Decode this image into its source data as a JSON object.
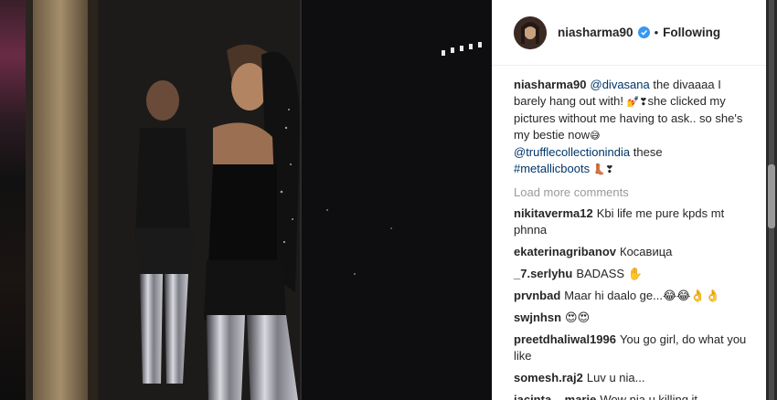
{
  "post": {
    "author": "niasharma90",
    "follow_status": "Following",
    "separator": "•",
    "caption": {
      "username": "niasharma90",
      "mention1": "@divasana",
      "text1": " the divaaaa I barely hang out with! ",
      "emoji1": "💅❣",
      "text2": "she clicked my pictures without me having to ask.. so she's my bestie now",
      "emoji2": "😅",
      "mention2": "@trufflecollectionindia",
      "text3": " these ",
      "hashtag": "#metallicboots",
      "emoji3": " 👢❣"
    },
    "load_more_label": "Load more comments",
    "comments": [
      {
        "user": "nikitaverma12",
        "text": "Kbi life me pure kpds mt phnna"
      },
      {
        "user": "ekaterinagribanov",
        "text": "Косавица"
      },
      {
        "user": "_7.serlyhu",
        "text": "BADASS ✋"
      },
      {
        "user": "prvnbad",
        "text": "Maar hi daalo ge...😂😂👌👌"
      },
      {
        "user": "swjnhsn",
        "text": "😍😍"
      },
      {
        "user": "preetdhaliwal1996",
        "text": "You go girl, do what you like"
      },
      {
        "user": "somesh.raj2",
        "text": "Luv u nia..."
      },
      {
        "user": "jacinta__marie",
        "text": "Wow nia u killing it"
      }
    ]
  },
  "colors": {
    "link": "#003569",
    "muted": "#999999",
    "verified": "#3897f0",
    "text": "#262626"
  }
}
